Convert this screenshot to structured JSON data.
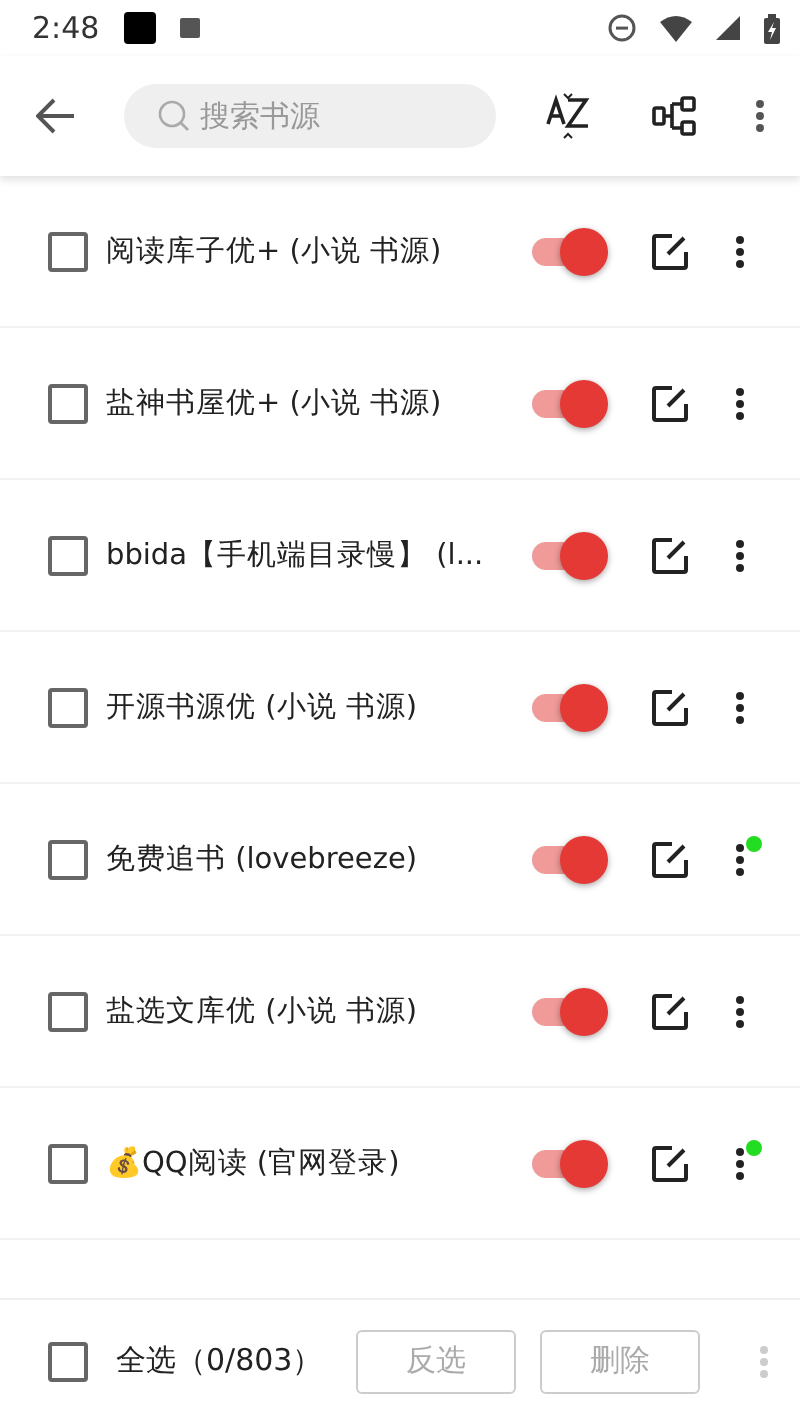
{
  "status_bar": {
    "time": "2:48"
  },
  "toolbar": {
    "search": {
      "placeholder": "搜索书源"
    }
  },
  "sources": [
    {
      "name": "阅读库子优+ (小说 书源)",
      "checked": false,
      "on": true
    },
    {
      "name": "盐神书屋优+ (小说 书源)",
      "checked": false,
      "on": true
    },
    {
      "name": "bbida【手机端目录慢】 (l...",
      "checked": false,
      "on": true
    },
    {
      "name": "开源书源优 (小说 书源)",
      "checked": false,
      "on": true
    },
    {
      "name": "免费追书 (lovebreeze)",
      "checked": false,
      "on": true,
      "color": "#22dd22"
    },
    {
      "name": "盐选文库优 (小说 书源)",
      "checked": false,
      "on": true
    },
    {
      "name": "💰QQ阅读 (官网登录)",
      "checked": false,
      "on": true,
      "color": "#22dd22"
    }
  ],
  "bottom_bar": {
    "select_all": {
      "label": "全选（0/803）",
      "checked": false
    },
    "buttons": [
      {
        "label": "反选",
        "disabled": true
      },
      {
        "label": "删除",
        "disabled": true
      }
    ]
  }
}
